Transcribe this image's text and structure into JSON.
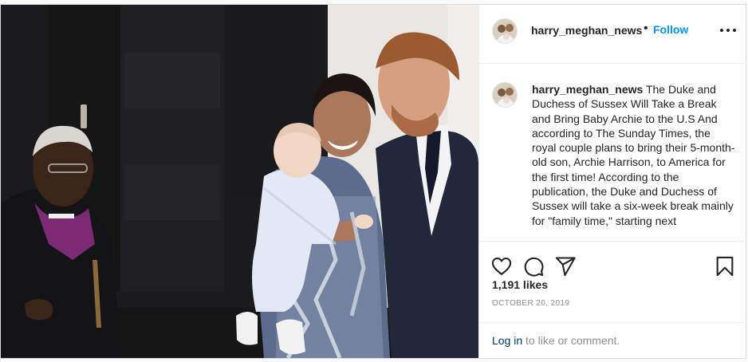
{
  "post": {
    "username": "harry_meghan_news",
    "separator": "•",
    "follow_label": "Follow",
    "more_icon": "more-options-icon",
    "photo_alt": "Desmond Tutu with Prince Harry, Meghan Markle and baby Archie",
    "caption": {
      "username": "harry_meghan_news",
      "text": "The Duke and Duchess of Sussex Will Take a Break and Bring Baby Archie to the U.S And according to The Sunday Times, the royal couple plans to bring their 5-month-old son, Archie Harrison, to America for the first time! According to the publication, the Duke and Duchess of Sussex will take a six-week break mainly for \"family time,\" starting next"
    },
    "likes": "1,191 likes",
    "date": "OCTOBER 20, 2019",
    "login_label": "Log in",
    "comment_prompt": " to like or comment."
  },
  "colors": {
    "accent": "#0095f6",
    "text": "#262626",
    "muted": "#8e8e8e",
    "border": "#efefef",
    "link": "#00376b"
  },
  "icons": [
    "heart-icon",
    "comment-icon",
    "share-icon",
    "bookmark-icon"
  ]
}
